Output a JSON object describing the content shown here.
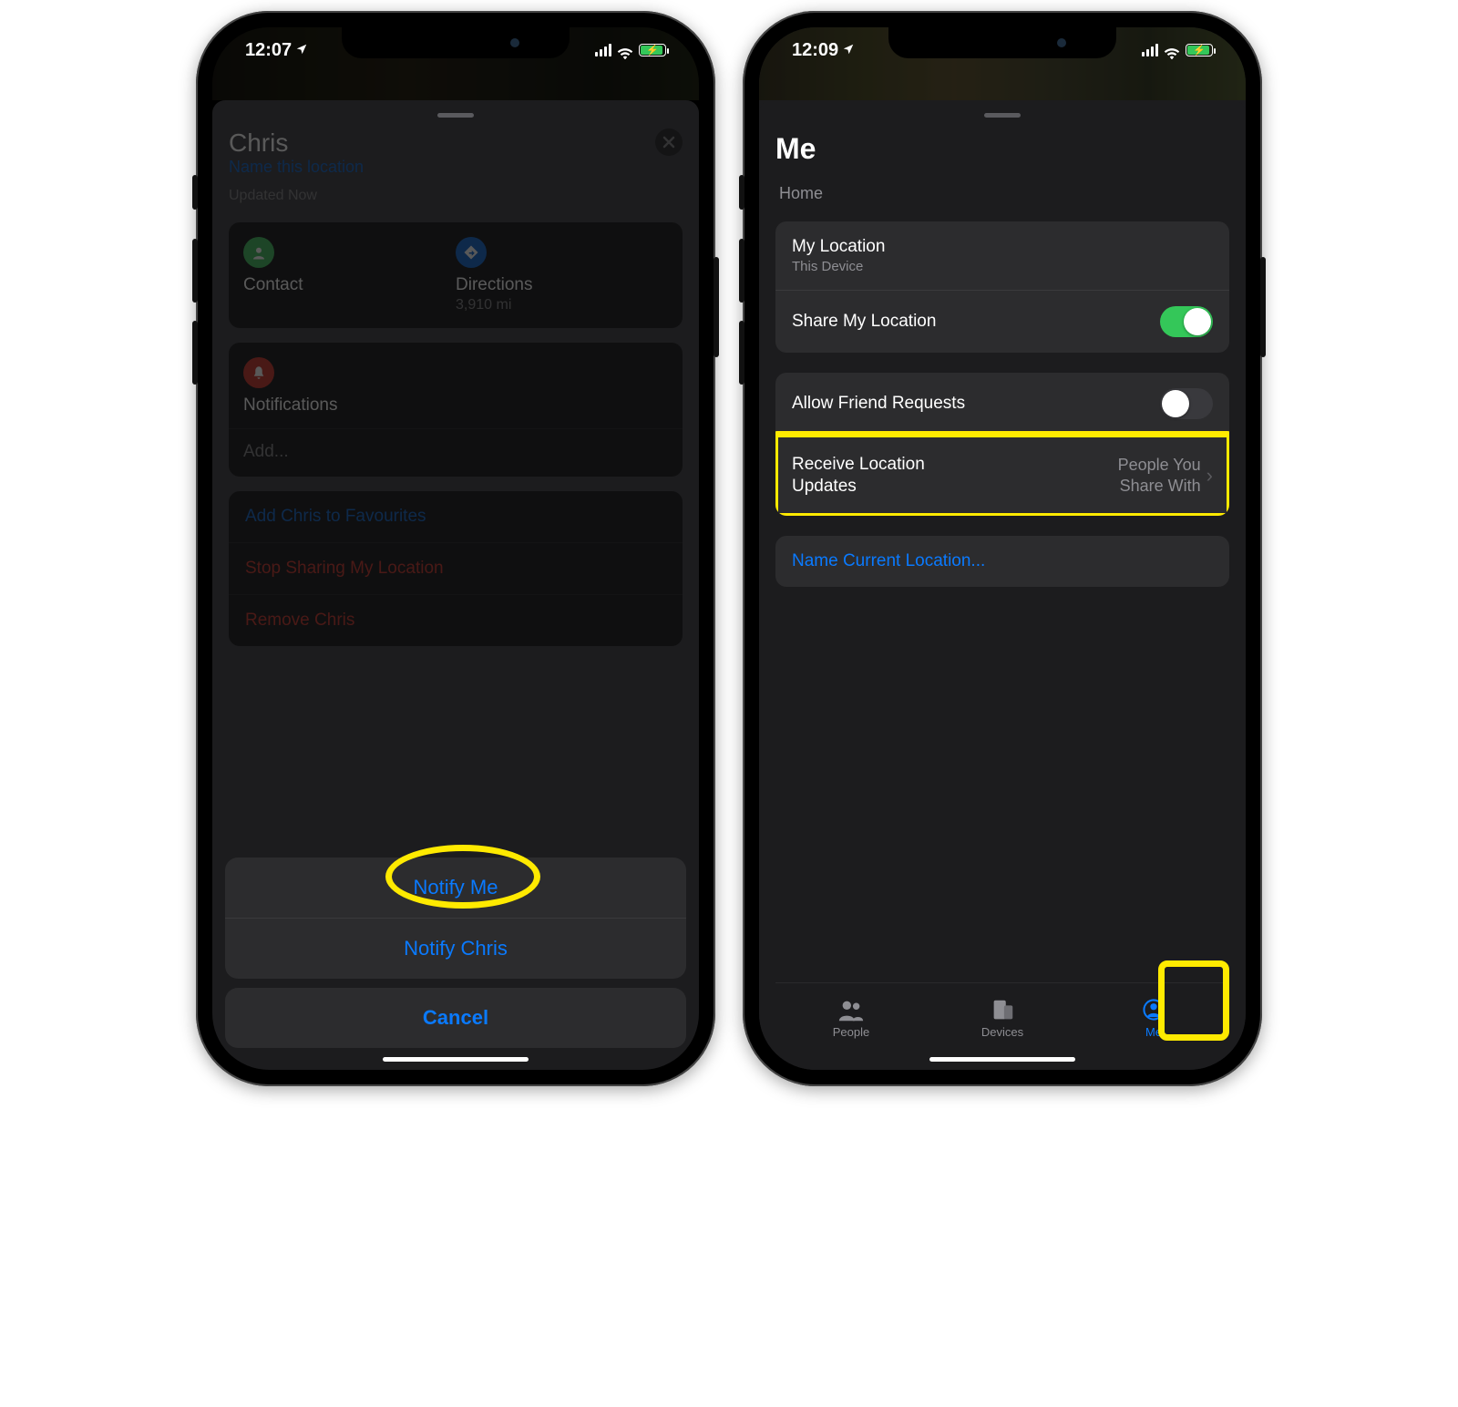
{
  "left": {
    "status": {
      "time": "12:07"
    },
    "person": {
      "name": "Chris",
      "name_location_link": "Name this location",
      "updated": "Updated Now"
    },
    "info": {
      "contact_label": "Contact",
      "directions_label": "Directions",
      "directions_distance": "3,910 mi"
    },
    "notif": {
      "title": "Notifications",
      "add": "Add..."
    },
    "actions": {
      "favourites": "Add Chris to Favourites",
      "stop_sharing": "Stop Sharing My Location",
      "remove": "Remove Chris"
    },
    "sheet": {
      "notify_me": "Notify Me",
      "notify_friend": "Notify Chris",
      "cancel": "Cancel"
    }
  },
  "right": {
    "status": {
      "time": "12:09"
    },
    "title": "Me",
    "section_label": "Home",
    "settings": {
      "my_location_label": "My Location",
      "my_location_value": "This Device",
      "share_label": "Share My Location",
      "share_on": true,
      "allow_label": "Allow Friend Requests",
      "allow_on": false,
      "receive_label": "Receive Location Updates",
      "receive_value": "People You Share With"
    },
    "name_loc": "Name Current Location...",
    "tabs": {
      "people": "People",
      "devices": "Devices",
      "me": "Me"
    }
  }
}
